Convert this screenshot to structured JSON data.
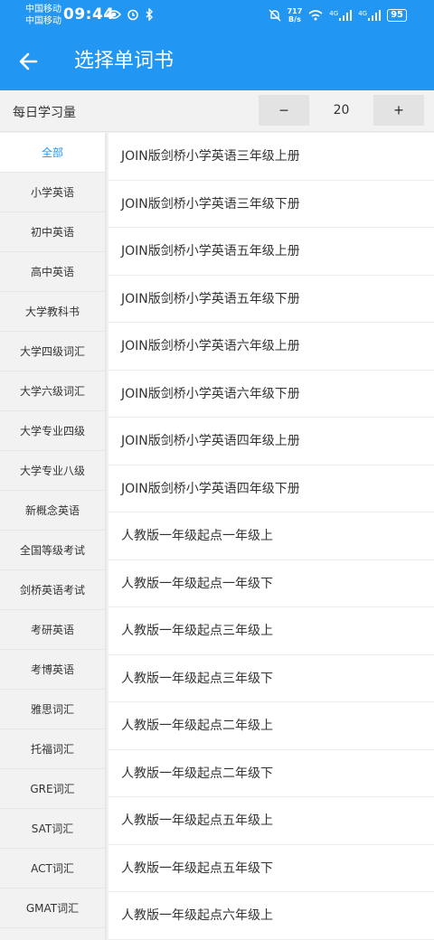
{
  "status_bar": {
    "carrier_1": "中国移动",
    "carrier_2": "中国移动",
    "time": "09:44",
    "net_speed_value": "717",
    "net_speed_unit": "B/s",
    "signal_1_label": "4G",
    "signal_2_label": "4G",
    "battery": "95"
  },
  "header": {
    "title": "选择单词书",
    "back_icon": "arrow-left-icon"
  },
  "daily": {
    "label": "每日学习量",
    "minus": "−",
    "plus": "+",
    "value": "20"
  },
  "categories": [
    {
      "label": "全部",
      "active": true
    },
    {
      "label": "小学英语"
    },
    {
      "label": "初中英语"
    },
    {
      "label": "高中英语"
    },
    {
      "label": "大学教科书"
    },
    {
      "label": "大学四级词汇"
    },
    {
      "label": "大学六级词汇"
    },
    {
      "label": "大学专业四级"
    },
    {
      "label": "大学专业八级"
    },
    {
      "label": "新概念英语"
    },
    {
      "label": "全国等级考试"
    },
    {
      "label": "剑桥英语考试"
    },
    {
      "label": "考研英语"
    },
    {
      "label": "考博英语"
    },
    {
      "label": "雅思词汇"
    },
    {
      "label": "托福词汇"
    },
    {
      "label": "GRE词汇"
    },
    {
      "label": "SAT词汇"
    },
    {
      "label": "ACT词汇"
    },
    {
      "label": "GMAT词汇"
    }
  ],
  "books": [
    "JOIN版剑桥小学英语三年级上册",
    "JOIN版剑桥小学英语三年级下册",
    "JOIN版剑桥小学英语五年级上册",
    "JOIN版剑桥小学英语五年级下册",
    "JOIN版剑桥小学英语六年级上册",
    "JOIN版剑桥小学英语六年级下册",
    "JOIN版剑桥小学英语四年级上册",
    "JOIN版剑桥小学英语四年级下册",
    "人教版一年级起点一年级上",
    "人教版一年级起点一年级下",
    "人教版一年级起点三年级上",
    "人教版一年级起点三年级下",
    "人教版一年级起点二年级上",
    "人教版一年级起点二年级下",
    "人教版一年级起点五年级上",
    "人教版一年级起点五年级下",
    "人教版一年级起点六年级上"
  ],
  "colors": {
    "primary": "#2196f3",
    "background": "#f2f2f2"
  }
}
